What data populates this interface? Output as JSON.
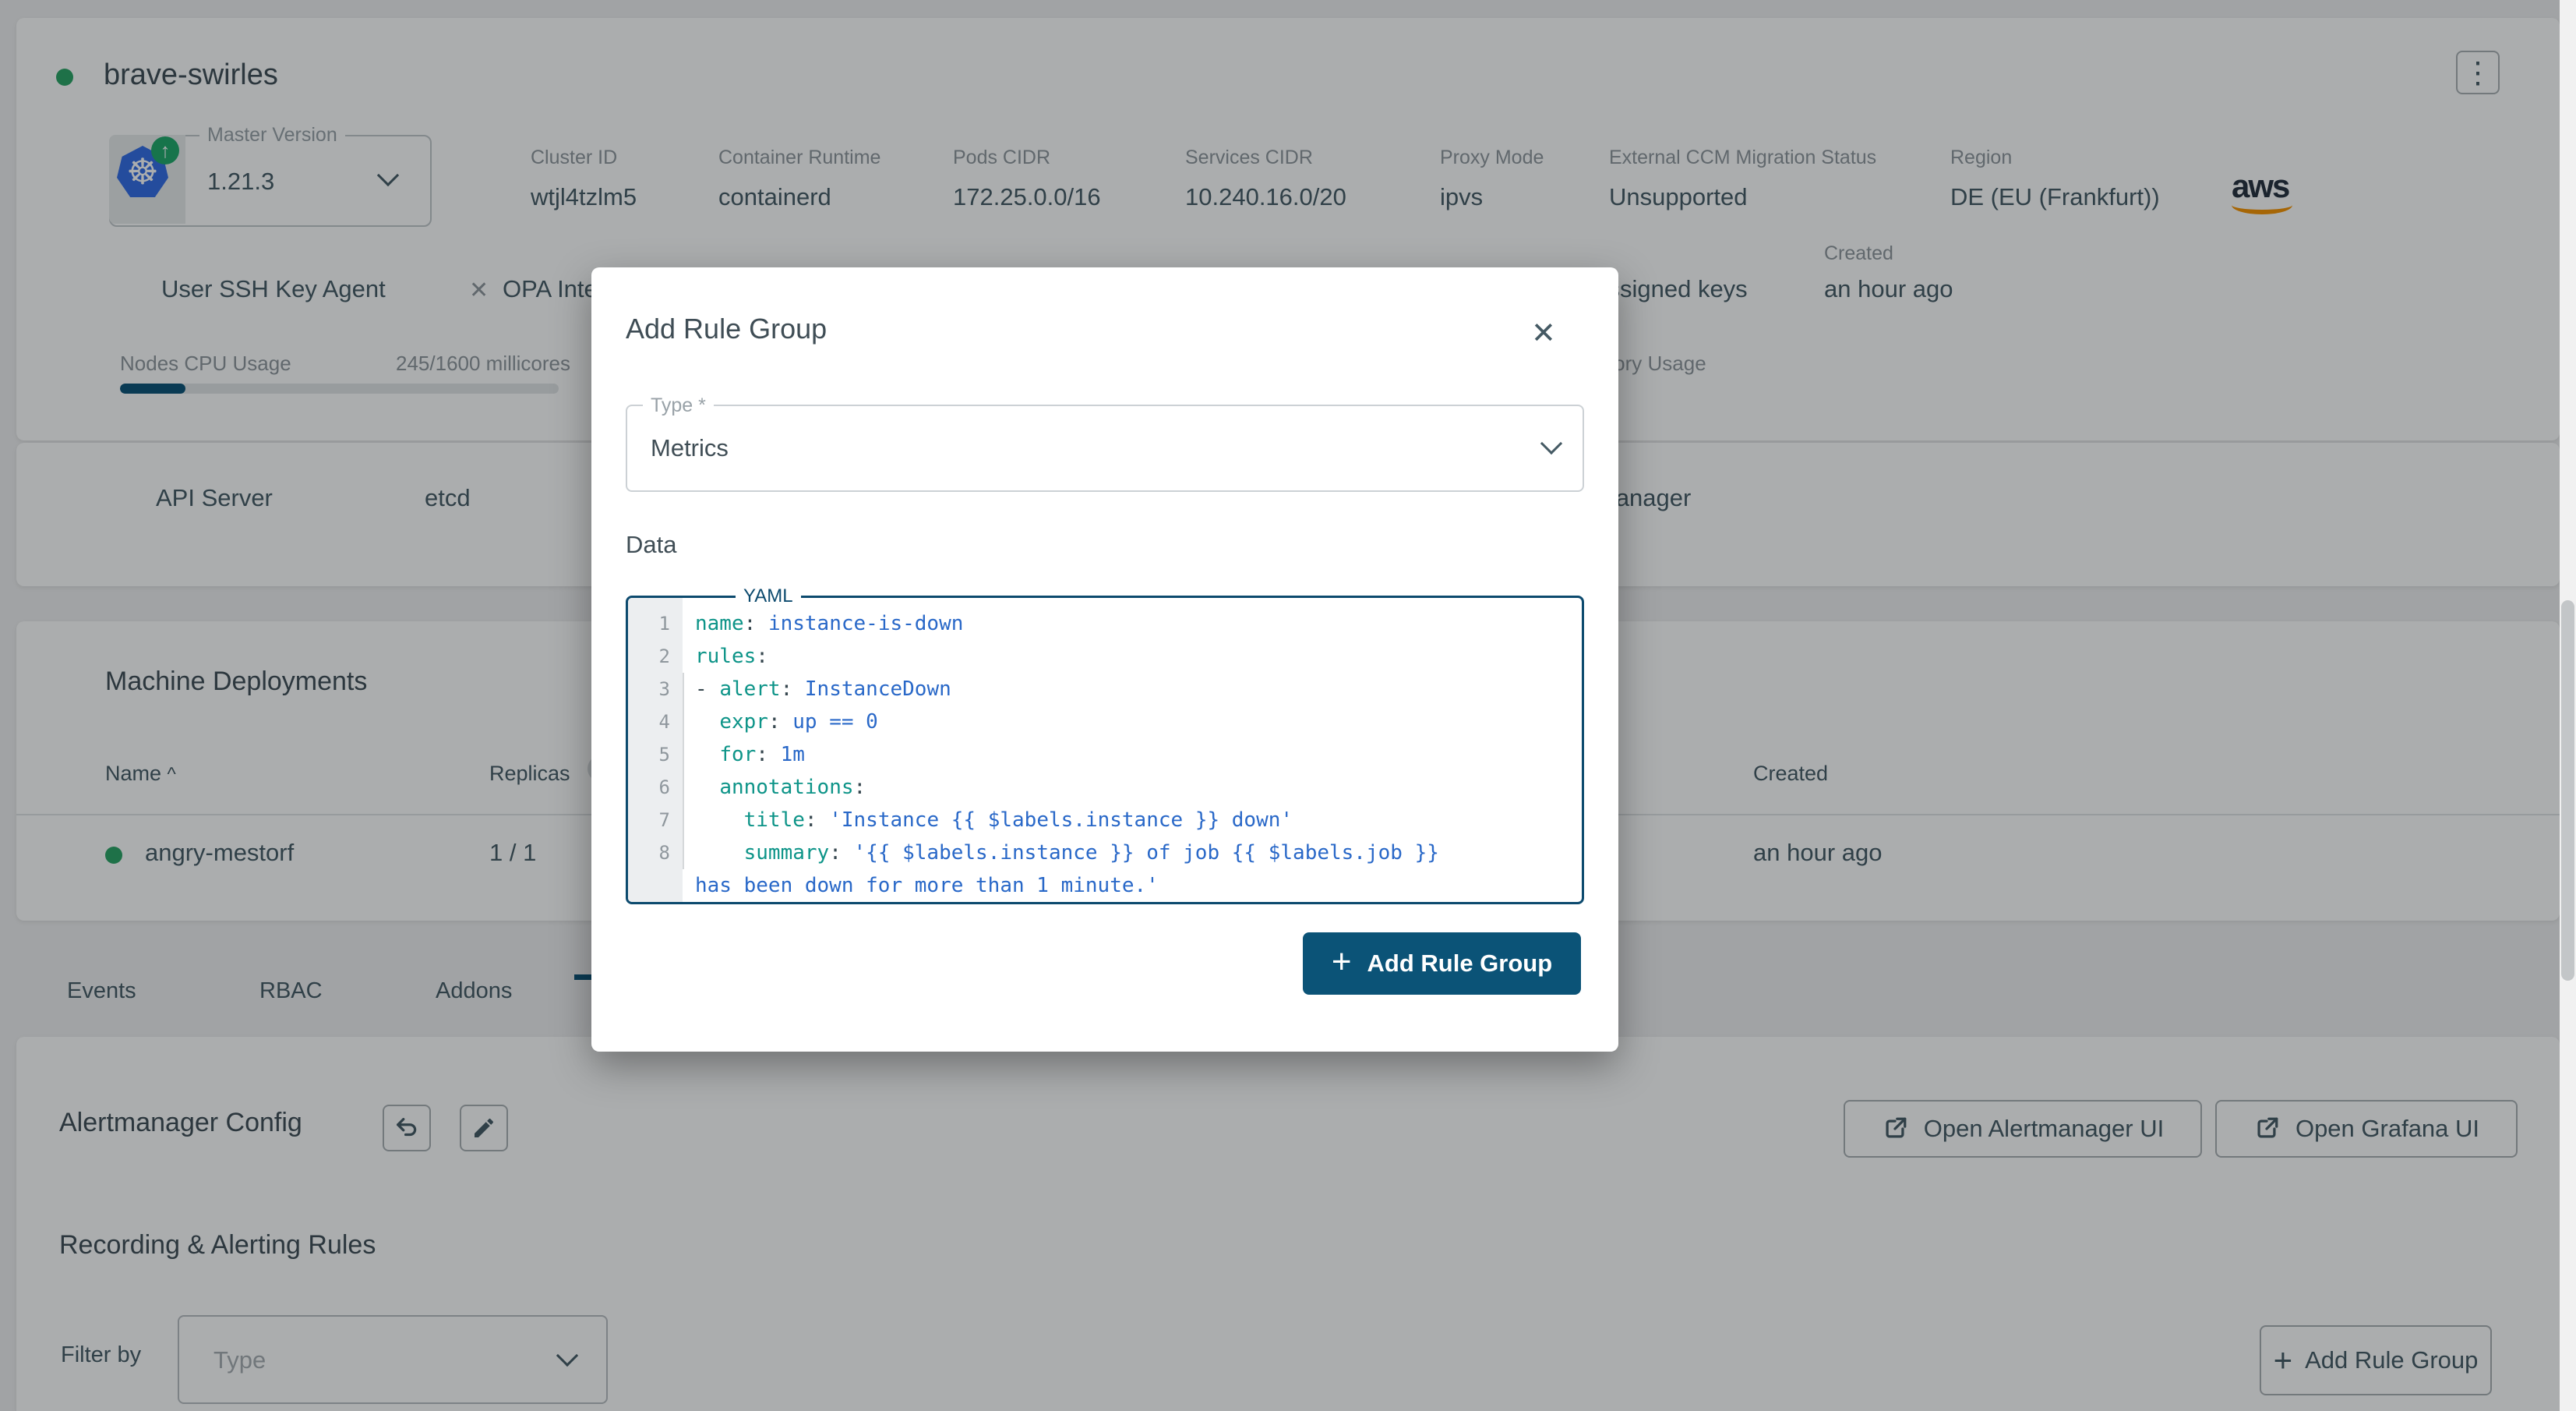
{
  "colors": {
    "primary_blue": "#0b5377",
    "status_green": "#2aa464",
    "editor_border": "#0c4a6e",
    "yaml_key": "#0d9488",
    "yaml_value": "#2968c8",
    "aws_orange": "#f79400",
    "k8s_blue": "#326de6"
  },
  "cluster": {
    "name": "brave-swirles",
    "menu_icon": "⋮",
    "master_version_label": "Master Version",
    "master_version": "1.21.3",
    "upgrade_badge": "↑",
    "k8s_glyph": "☸",
    "info": [
      {
        "label": "Cluster ID",
        "value": "wtjl4tzlm5"
      },
      {
        "label": "Container Runtime",
        "value": "containerd"
      },
      {
        "label": "Pods CIDR",
        "value": "172.25.0.0/16"
      },
      {
        "label": "Services CIDR",
        "value": "10.240.16.0/20"
      },
      {
        "label": "Proxy Mode",
        "value": "ipvs"
      },
      {
        "label": "External CCM Migration Status",
        "value": "Unsupported"
      },
      {
        "label": "Region",
        "value": "DE (EU (Frankfurt))"
      }
    ],
    "provider": "aws",
    "features": {
      "ssh_agent": "User SSH Key Agent",
      "opa_icon": "✕",
      "opa": "OPA Integration"
    },
    "ssh_keys": "No assigned keys",
    "created_label": "Created",
    "created_value": "an hour ago",
    "cpu_label": "Nodes CPU Usage",
    "cpu_value": "245/1600 millicores",
    "cpu_percent": 15,
    "memory_label": "Nodes Memory Usage"
  },
  "control_plane": {
    "api_server": "API Server",
    "etcd": "etcd",
    "controller_manager": "Controller Manager"
  },
  "machine_deployments": {
    "title": "Machine Deployments",
    "columns": {
      "name": "Name",
      "sort_icon": "^",
      "replicas": "Replicas",
      "info_icon": "i",
      "created": "Created"
    },
    "rows": [
      {
        "name": "angry-mestorf",
        "replicas": "1 / 1",
        "created": "an hour ago"
      }
    ]
  },
  "tabs": {
    "events": "Events",
    "rbac": "RBAC",
    "addons": "Addons"
  },
  "alertmanager": {
    "title": "Alertmanager Config",
    "open_alertmanager": "Open Alertmanager UI",
    "open_grafana": "Open Grafana UI"
  },
  "rules": {
    "title": "Recording & Alerting Rules",
    "filter_label": "Filter by",
    "filter_placeholder": "Type",
    "add_button_plus": "+",
    "add_button": "Add Rule Group"
  },
  "modal": {
    "title": "Add Rule Group",
    "close_icon": "✕",
    "type_label": "Type *",
    "type_value": "Metrics",
    "data_label": "Data",
    "editor_label": "YAML",
    "submit_plus": "+",
    "submit": "Add Rule Group",
    "yaml_lines": [
      {
        "n": "1",
        "segs": [
          [
            "k",
            "name"
          ],
          [
            "p",
            ": "
          ],
          [
            "v",
            "instance-is-down"
          ]
        ]
      },
      {
        "n": "2",
        "segs": [
          [
            "k",
            "rules"
          ],
          [
            "p",
            ":"
          ]
        ]
      },
      {
        "n": "3",
        "segs": [
          [
            "p",
            "- "
          ],
          [
            "k",
            "alert"
          ],
          [
            "p",
            ": "
          ],
          [
            "v",
            "InstanceDown"
          ]
        ]
      },
      {
        "n": "4",
        "segs": [
          [
            "p",
            "  "
          ],
          [
            "k",
            "expr"
          ],
          [
            "p",
            ": "
          ],
          [
            "v",
            "up == 0"
          ]
        ]
      },
      {
        "n": "5",
        "segs": [
          [
            "p",
            "  "
          ],
          [
            "k",
            "for"
          ],
          [
            "p",
            ": "
          ],
          [
            "v",
            "1m"
          ]
        ]
      },
      {
        "n": "6",
        "segs": [
          [
            "p",
            "  "
          ],
          [
            "k",
            "annotations"
          ],
          [
            "p",
            ":"
          ]
        ]
      },
      {
        "n": "7",
        "segs": [
          [
            "p",
            "    "
          ],
          [
            "k",
            "title"
          ],
          [
            "p",
            ": "
          ],
          [
            "v",
            "'Instance {{ $labels.instance }} down'"
          ]
        ]
      },
      {
        "n": "8",
        "segs": [
          [
            "p",
            "    "
          ],
          [
            "k",
            "summary"
          ],
          [
            "p",
            ": "
          ],
          [
            "v",
            "'{{ $labels.instance }} of job {{ $labels.job }}"
          ]
        ]
      },
      {
        "n": "",
        "segs": [
          [
            "v",
            "has been down for more than 1 minute.'"
          ]
        ]
      }
    ]
  }
}
